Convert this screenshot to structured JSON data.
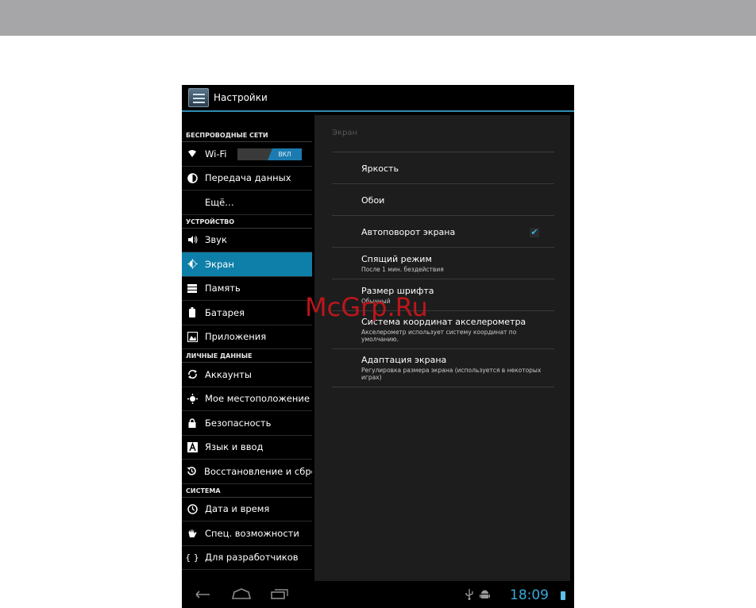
{
  "action_bar": {
    "title": "Настройки"
  },
  "sidebar": {
    "sections": [
      {
        "header": "БЕСПРОВОДНЫЕ СЕТИ",
        "items": [
          {
            "label": "Wi-Fi",
            "icon": "wifi-icon",
            "toggle": "ВКЛ"
          },
          {
            "label": "Передача данных",
            "icon": "data-usage-icon"
          },
          {
            "label": "Ещё…",
            "icon": ""
          }
        ]
      },
      {
        "header": "УСТРОЙСТВО",
        "items": [
          {
            "label": "Звук",
            "icon": "sound-icon"
          },
          {
            "label": "Экран",
            "icon": "display-icon",
            "selected": true
          },
          {
            "label": "Память",
            "icon": "storage-icon"
          },
          {
            "label": "Батарея",
            "icon": "battery-icon"
          },
          {
            "label": "Приложения",
            "icon": "apps-icon"
          }
        ]
      },
      {
        "header": "ЛИЧНЫЕ ДАННЫЕ",
        "items": [
          {
            "label": "Аккаунты",
            "icon": "sync-icon"
          },
          {
            "label": "Мое местоположение",
            "icon": "location-icon"
          },
          {
            "label": "Безопасность",
            "icon": "lock-icon"
          },
          {
            "label": "Язык и ввод",
            "icon": "language-icon"
          },
          {
            "label": "Восстановление и сбро",
            "icon": "backup-icon"
          }
        ]
      },
      {
        "header": "СИСТЕМА",
        "items": [
          {
            "label": "Дата и время",
            "icon": "clock-icon"
          },
          {
            "label": "Спец. возможности",
            "icon": "accessibility-icon"
          },
          {
            "label": "Для разработчиков",
            "icon": "developer-icon"
          }
        ]
      }
    ]
  },
  "panel": {
    "title": "Экран",
    "rows": [
      {
        "title": "Яркость"
      },
      {
        "title": "Обои"
      },
      {
        "title": "Автоповорот экрана",
        "checked": true
      },
      {
        "title": "Спящий режим",
        "summary": "После 1 мин. бездействия"
      },
      {
        "title": "Размер шрифта",
        "summary": "Обычный"
      },
      {
        "title": "Система координат акселерометра",
        "summary": "Акселерометр использует систему координат по умолчанию."
      },
      {
        "title": "Адаптация экрана",
        "summary": "Регулировка размера экрана (используется в некоторых играх)"
      }
    ]
  },
  "status_bar": {
    "time": "18:09"
  },
  "watermark": "McGrp.Ru",
  "colors": {
    "accent": "#0e7fa8",
    "clock": "#3aa8d8",
    "check": "#33b5e5"
  }
}
